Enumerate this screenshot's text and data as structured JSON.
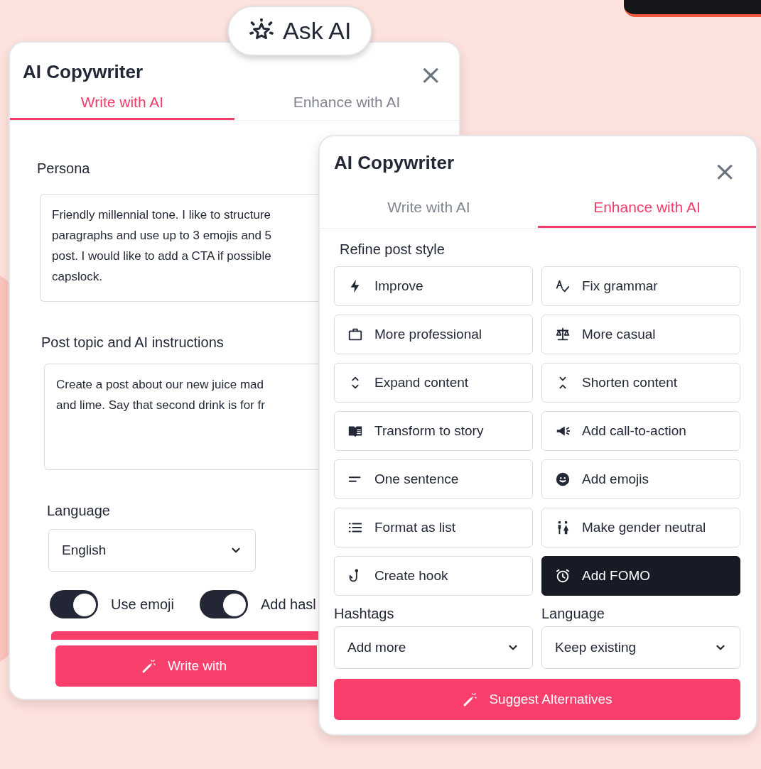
{
  "ask_ai_badge": {
    "label": "Ask AI"
  },
  "back_panel": {
    "title": "AI Copywriter",
    "close": "×",
    "tabs": [
      {
        "label": "Write with AI",
        "selected": true
      },
      {
        "label": "Enhance with AI",
        "selected": false
      }
    ],
    "persona": {
      "label": "Persona",
      "lines": [
        "Friendly millennial tone. I like to structure",
        "paragraphs and use up to 3 emojis and 5",
        "post. I would like to add a CTA if possible",
        "capslock."
      ]
    },
    "instructions": {
      "label": "Post topic and AI instructions",
      "lines": [
        "Create a post about our new juice mad",
        "and lime. Say that second drink is for fr"
      ]
    },
    "language": {
      "label": "Language",
      "value": "English"
    },
    "toggles": [
      {
        "label": "Use emoji",
        "on": true
      },
      {
        "label": "Add hasl",
        "on": true
      }
    ],
    "button": "Write with"
  },
  "front_panel": {
    "title": "AI Copywriter",
    "close": "×",
    "tabs": [
      {
        "label": "Write with AI",
        "selected": false
      },
      {
        "label": "Enhance with AI",
        "selected": true
      }
    ],
    "section_label": "Refine post style",
    "actions": [
      {
        "label": "Improve",
        "selected": false
      },
      {
        "label": "Fix grammar",
        "selected": false
      },
      {
        "label": "More professional",
        "selected": false
      },
      {
        "label": "More casual",
        "selected": false
      },
      {
        "label": "Expand content",
        "selected": false
      },
      {
        "label": "Shorten content",
        "selected": false
      },
      {
        "label": "Transform to story",
        "selected": false
      },
      {
        "label": "Add call-to-action",
        "selected": false
      },
      {
        "label": "One sentence",
        "selected": false
      },
      {
        "label": "Add emojis",
        "selected": false
      },
      {
        "label": "Format as list",
        "selected": false
      },
      {
        "label": "Make gender neutral",
        "selected": false
      },
      {
        "label": "Create hook",
        "selected": false
      },
      {
        "label": "Add FOMO",
        "selected": true
      }
    ],
    "hashtags": {
      "label": "Hashtags",
      "value": "Add more"
    },
    "language": {
      "label": "Language",
      "value": "Keep existing"
    },
    "button": "Suggest Alternatives"
  }
}
